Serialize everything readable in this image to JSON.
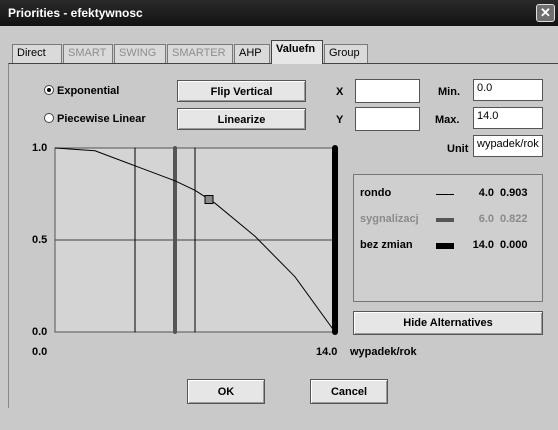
{
  "window": {
    "title": "Priorities - efektywnosc"
  },
  "tabs": [
    {
      "label": "Direct",
      "state": "enabled"
    },
    {
      "label": "SMART",
      "state": "disabled"
    },
    {
      "label": "SWING",
      "state": "disabled"
    },
    {
      "label": "SMARTER",
      "state": "disabled"
    },
    {
      "label": "AHP",
      "state": "enabled"
    },
    {
      "label": "Valuefn",
      "state": "active"
    },
    {
      "label": "Group",
      "state": "enabled"
    }
  ],
  "function_type": {
    "exponential": {
      "label": "Exponential",
      "selected": true
    },
    "piecewise_linear": {
      "label": "Piecewise Linear",
      "selected": false
    }
  },
  "buttons": {
    "flip_vertical": "Flip Vertical",
    "linearize": "Linearize",
    "hide_alternatives": "Hide Alternatives",
    "ok": "OK",
    "cancel": "Cancel"
  },
  "fields": {
    "x_label": "X",
    "x_value": "",
    "y_label": "Y",
    "y_value": "",
    "min_label": "Min.",
    "min_value": "0.0",
    "max_label": "Max.",
    "max_value": "14.0",
    "unit_label": "Unit",
    "unit_value": "wypadek/rok"
  },
  "alternatives": [
    {
      "name": "rondo",
      "value": "4.0",
      "score": "0.903",
      "color": "#000000",
      "weight": 1,
      "muted": false
    },
    {
      "name": "sygnalizacj",
      "value": "6.0",
      "score": "0.822",
      "color": "#555555",
      "weight": 4,
      "muted": true
    },
    {
      "name": "bez zmian",
      "value": "14.0",
      "score": "0.000",
      "color": "#000000",
      "weight": 6,
      "muted": false
    }
  ],
  "chart_data": {
    "type": "line",
    "xlim": [
      0,
      14
    ],
    "ylim": [
      0,
      1
    ],
    "x_tick_labels": [
      "0.0",
      "14.0"
    ],
    "y_tick_labels": [
      "1.0",
      "0.5",
      "0.0"
    ],
    "x_unit": "wypadek/rok",
    "curve": {
      "shape": "exponential",
      "x": [
        0,
        2,
        4,
        6,
        7,
        8,
        10,
        12,
        14
      ],
      "y": [
        1.0,
        0.985,
        0.903,
        0.822,
        0.77,
        0.7,
        0.52,
        0.3,
        0.0
      ]
    },
    "marker": {
      "x": 7.7,
      "y": 0.72
    },
    "vertical_lines": [
      {
        "x": 4.0,
        "weight": 1,
        "color": "#000000"
      },
      {
        "x": 6.0,
        "weight": 4,
        "color": "#555555"
      },
      {
        "x": 7.0,
        "weight": 1,
        "color": "#000000"
      },
      {
        "x": 14.0,
        "weight": 6,
        "color": "#000000"
      }
    ],
    "grid": {
      "horizontal_at": [
        0.5
      ]
    }
  }
}
